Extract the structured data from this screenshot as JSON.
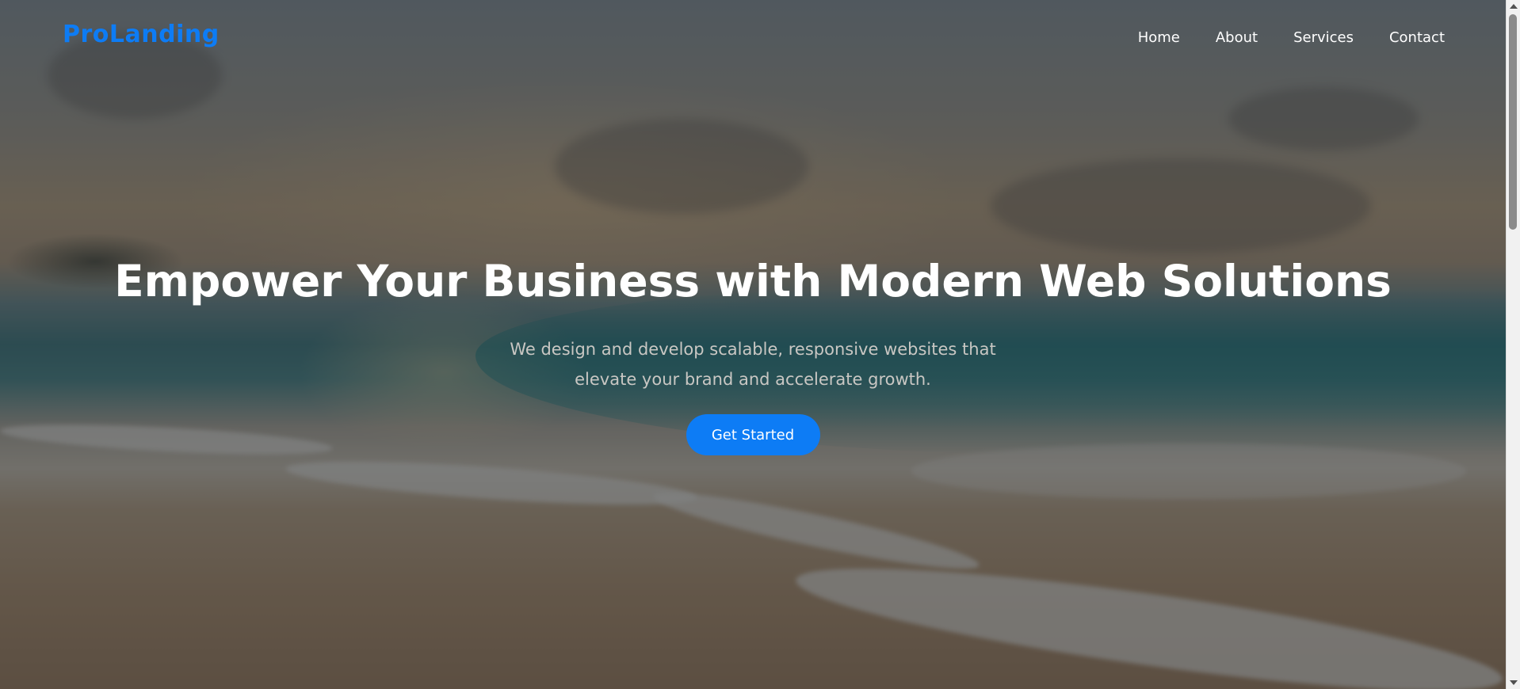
{
  "navbar": {
    "brand": "ProLanding",
    "links": [
      {
        "label": "Home"
      },
      {
        "label": "About"
      },
      {
        "label": "Services"
      },
      {
        "label": "Contact"
      }
    ]
  },
  "hero": {
    "title": "Empower Your Business with Modern Web Solutions",
    "subtitle": "We design and develop scalable, responsive websites that elevate your brand and accelerate growth.",
    "cta_label": "Get Started",
    "background": "beach-sunset-photo"
  },
  "colors": {
    "brand": "#0d7cf5",
    "cta_background": "#0d7cf5",
    "title_text": "#ffffff",
    "subtitle_text": "#c9c7c3"
  }
}
